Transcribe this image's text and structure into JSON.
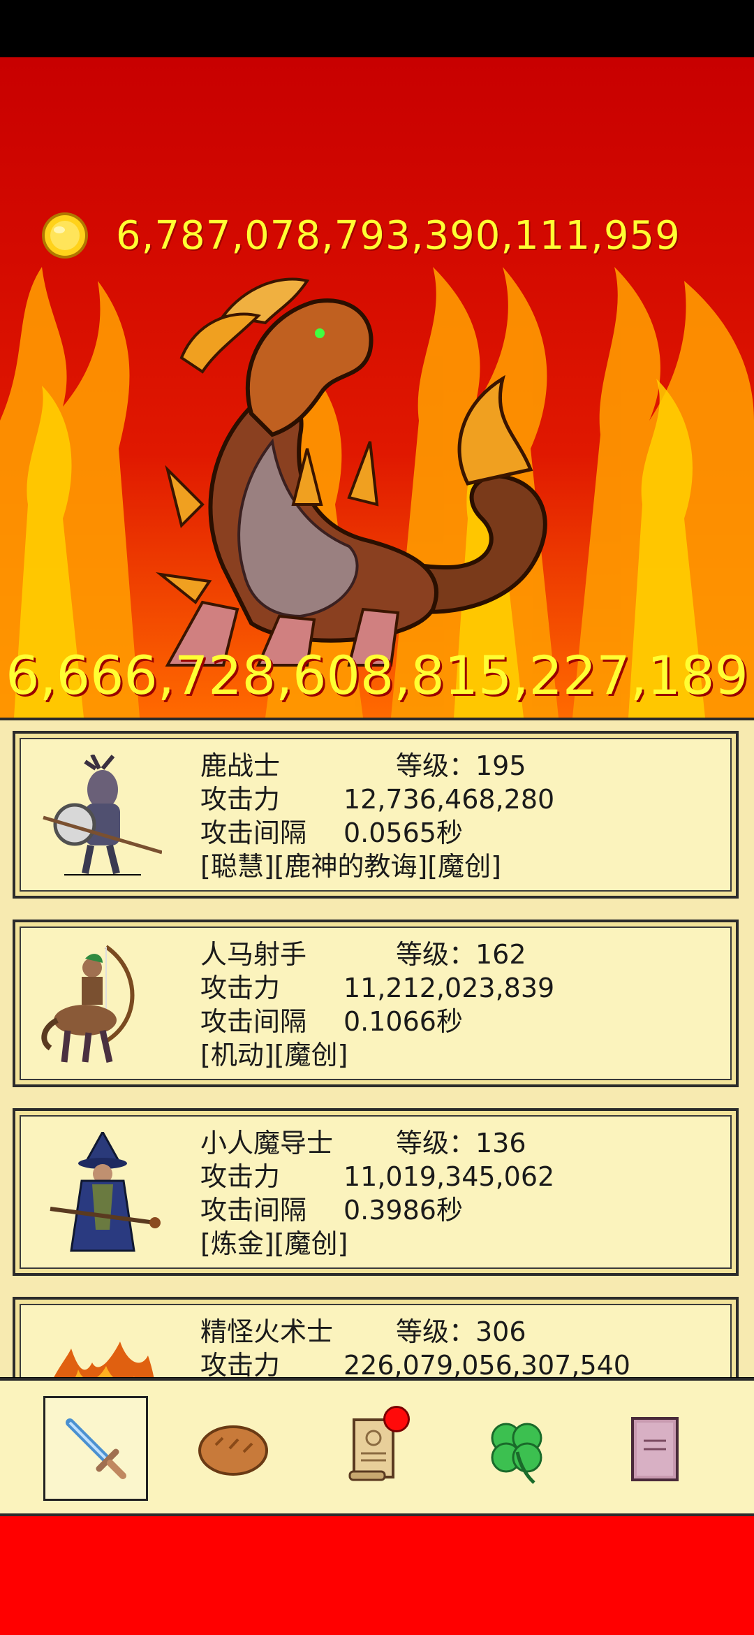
{
  "header": {
    "gold_amount": "6,787,078,793,390,111,959",
    "gold_icon": "gold-coin-icon"
  },
  "boss": {
    "name_icon": "fire-dragon-boss",
    "hp": "6,666,728,608,815,227,189"
  },
  "colors": {
    "battle_bg": "#d40a00",
    "gold_text": "#ffff33",
    "panel_bg": "#f7eab0",
    "nav_footer": "#ff0000"
  },
  "heroes": [
    {
      "name": "鹿战士",
      "level_label": "等级：195",
      "attack_label": "攻击力",
      "attack_value": "12,736,468,280",
      "interval_label": "攻击间隔",
      "interval_value": "0.0565秒",
      "tags": "[聪慧][鹿神的教诲][魔创]",
      "portrait_icon": "deer-warrior-icon"
    },
    {
      "name": "人马射手",
      "level_label": "等级：162",
      "attack_label": "攻击力",
      "attack_value": "11,212,023,839",
      "interval_label": "攻击间隔",
      "interval_value": "0.1066秒",
      "tags": "[机动][魔创]",
      "portrait_icon": "centaur-archer-icon"
    },
    {
      "name": "小人魔导士",
      "level_label": "等级：136",
      "attack_label": "攻击力",
      "attack_value": "11,019,345,062",
      "interval_label": "攻击间隔",
      "interval_value": "0.3986秒",
      "tags": "[炼金][魔创]",
      "portrait_icon": "dwarf-mage-icon"
    },
    {
      "name": "精怪火术士",
      "level_label": "等级：306",
      "attack_label": "攻击力",
      "attack_value": "226,079,056,307,540",
      "interval_label": "",
      "interval_value": "",
      "tags": "",
      "portrait_icon": "fire-sprite-icon"
    }
  ],
  "nav": [
    {
      "icon": "sword-icon",
      "selected": true
    },
    {
      "icon": "bread-icon",
      "selected": false
    },
    {
      "icon": "scroll-icon",
      "selected": false,
      "badge": true
    },
    {
      "icon": "clover-icon",
      "selected": false
    },
    {
      "icon": "book-icon",
      "selected": false
    }
  ]
}
